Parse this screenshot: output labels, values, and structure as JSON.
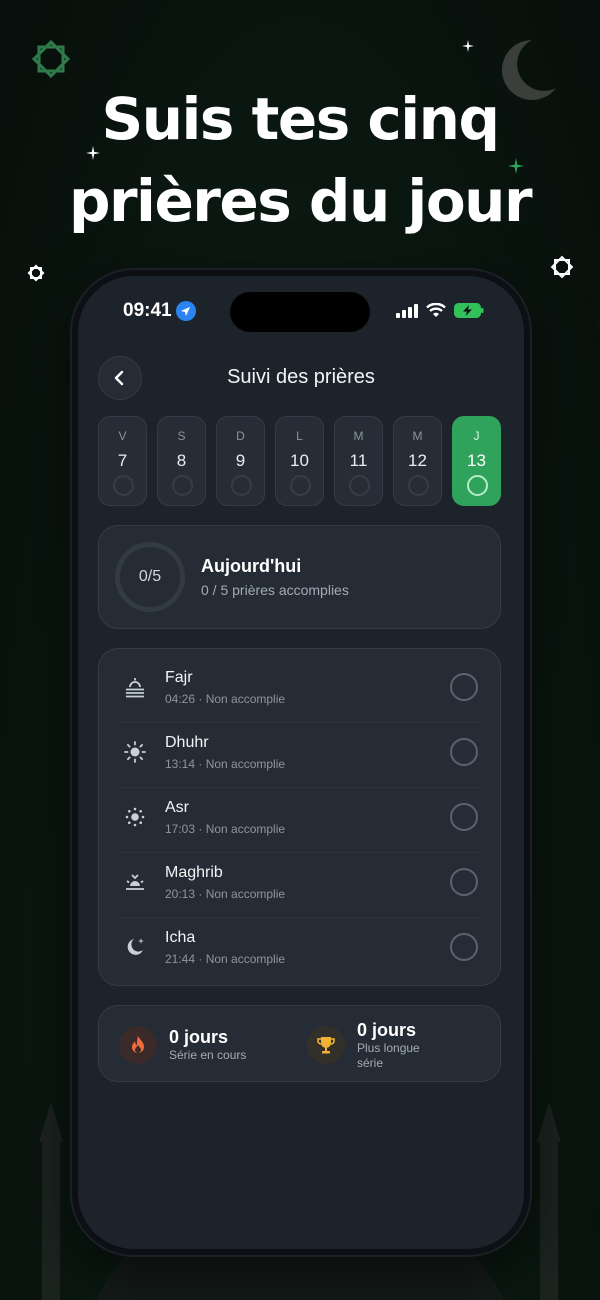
{
  "headline": {
    "line1": "Suis tes cinq",
    "line2": "prières du jour"
  },
  "status_bar": {
    "time": "09:41"
  },
  "nav": {
    "title": "Suivi des prières"
  },
  "days": [
    {
      "letter": "V",
      "num": "7",
      "active": false
    },
    {
      "letter": "S",
      "num": "8",
      "active": false
    },
    {
      "letter": "D",
      "num": "9",
      "active": false
    },
    {
      "letter": "L",
      "num": "10",
      "active": false
    },
    {
      "letter": "M",
      "num": "11",
      "active": false
    },
    {
      "letter": "M",
      "num": "12",
      "active": false
    },
    {
      "letter": "J",
      "num": "13",
      "active": true
    }
  ],
  "today": {
    "progress": "0/5",
    "title": "Aujourd'hui",
    "subtitle": "0 / 5 prières accomplies"
  },
  "prayers": [
    {
      "name": "Fajr",
      "detail": "04:26 · Non accomplie",
      "icon": "sunrise-icon"
    },
    {
      "name": "Dhuhr",
      "detail": "13:14 · Non accomplie",
      "icon": "sun-icon"
    },
    {
      "name": "Asr",
      "detail": "17:03 · Non accomplie",
      "icon": "sun-small-icon"
    },
    {
      "name": "Maghrib",
      "detail": "20:13 · Non accomplie",
      "icon": "sunset-icon"
    },
    {
      "name": "Icha",
      "detail": "21:44 · Non accomplie",
      "icon": "moon-stars-icon"
    }
  ],
  "streak": {
    "current_value": "0 jours",
    "current_label": "Série en cours",
    "longest_value": "0 jours",
    "longest_label_1": "Plus longue",
    "longest_label_2": "série"
  },
  "colors": {
    "accent": "#2fa35b",
    "card": "#252c35",
    "background": "#1d232b"
  }
}
